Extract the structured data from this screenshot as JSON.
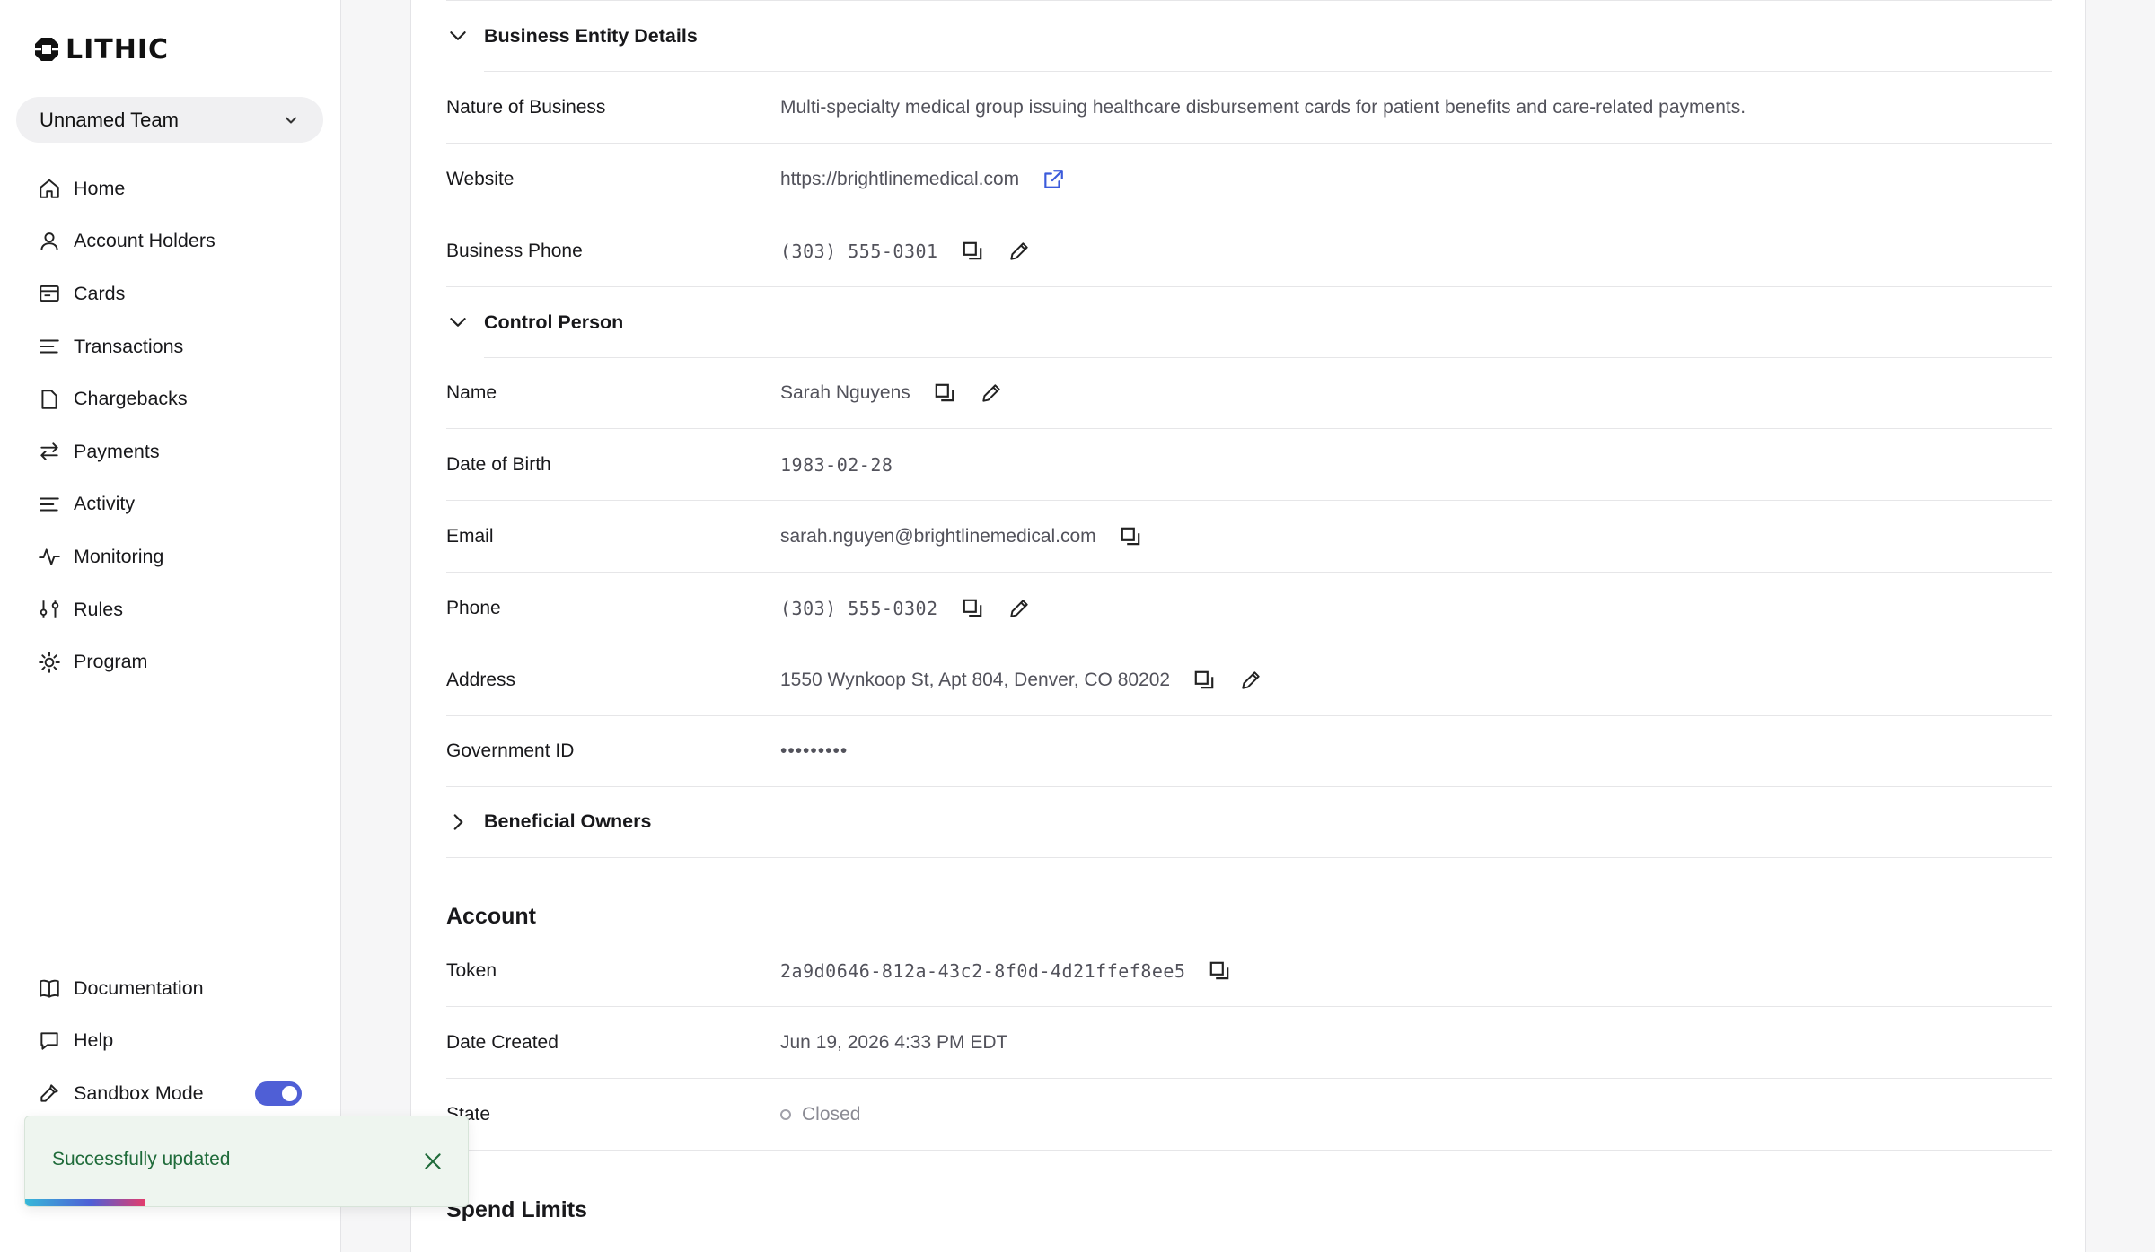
{
  "brand": {
    "name": "LITHIC"
  },
  "team_selector": {
    "value": "Unnamed Team"
  },
  "nav": {
    "items": [
      {
        "label": "Home"
      },
      {
        "label": "Account Holders"
      },
      {
        "label": "Cards"
      },
      {
        "label": "Transactions"
      },
      {
        "label": "Chargebacks"
      },
      {
        "label": "Payments"
      },
      {
        "label": "Activity"
      },
      {
        "label": "Monitoring"
      },
      {
        "label": "Rules"
      },
      {
        "label": "Program"
      }
    ],
    "bottom": [
      {
        "label": "Documentation"
      },
      {
        "label": "Help"
      },
      {
        "label": "Sandbox Mode"
      }
    ],
    "sandbox_on": true
  },
  "business": {
    "section_title": "Business Entity Details",
    "nature_label": "Nature of Business",
    "nature_value": "Multi-specialty medical group issuing healthcare disbursement cards for patient benefits and care-related payments.",
    "website_label": "Website",
    "website_value": "https://brightlinemedical.com",
    "phone_label": "Business Phone",
    "phone_value": "(303) 555-0301"
  },
  "control_person": {
    "section_title": "Control Person",
    "name_label": "Name",
    "name_value": "Sarah Nguyens",
    "dob_label": "Date of Birth",
    "dob_value": "1983-02-28",
    "email_label": "Email",
    "email_value": "sarah.nguyen@brightlinemedical.com",
    "phone_label": "Phone",
    "phone_value": "(303) 555-0302",
    "address_label": "Address",
    "address_value": "1550 Wynkoop St, Apt 804, Denver, CO 80202",
    "govid_label": "Government ID",
    "govid_value": "•••••••••"
  },
  "beneficial_owners": {
    "section_title": "Beneficial Owners"
  },
  "account": {
    "heading": "Account",
    "token_label": "Token",
    "token_value": "2a9d0646-812a-43c2-8f0d-4d21ffef8ee5",
    "created_label": "Date Created",
    "created_value": "Jun 19, 2026 4:33 PM EDT",
    "state_label": "State",
    "state_value": "Closed"
  },
  "spend_limits": {
    "heading": "Spend Limits"
  },
  "toast": {
    "message": "Successfully updated",
    "progress": 0.27
  },
  "colors": {
    "accent": "#4f5fd6",
    "link_icon": "#3b5bdb",
    "toast_text": "#1f6b3a"
  }
}
